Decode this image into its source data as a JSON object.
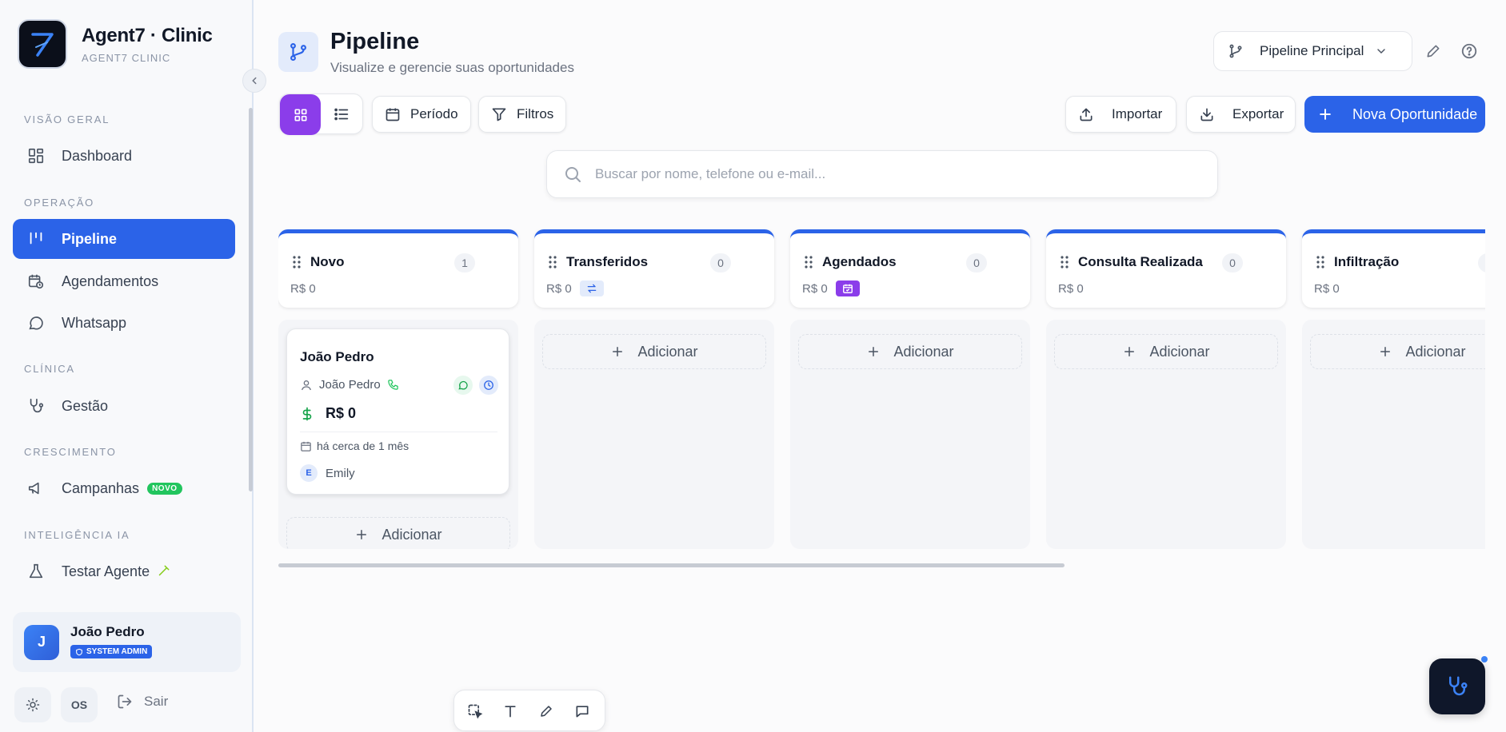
{
  "brand": {
    "title": "Agent7 · Clinic",
    "subtitle": "AGENT7 CLINIC"
  },
  "sidebar": {
    "sections": [
      {
        "label": "VISÃO GERAL"
      },
      {
        "label": "OPERAÇÃO"
      },
      {
        "label": "CLÍNICA"
      },
      {
        "label": "CRESCIMENTO"
      },
      {
        "label": "INTELIGÊNCIA IA"
      }
    ],
    "items": [
      {
        "label": "Dashboard",
        "icon": "dashboard-icon"
      },
      {
        "label": "Pipeline",
        "icon": "pipeline-icon",
        "active": true
      },
      {
        "label": "Agendamentos",
        "icon": "calendar-clock-icon"
      },
      {
        "label": "Whatsapp",
        "icon": "chat-bubble-icon"
      },
      {
        "label": "Gestão",
        "icon": "stethoscope-icon"
      },
      {
        "label": "Campanhas",
        "icon": "megaphone-icon",
        "badge": "NOVO"
      },
      {
        "label": "Testar Agente",
        "icon": "flask-icon"
      }
    ],
    "user": {
      "initial": "J",
      "name": "João Pedro",
      "role": "SYSTEM ADMIN"
    },
    "footer": {
      "language": "OS",
      "logout": "Sair"
    }
  },
  "header": {
    "title": "Pipeline",
    "subtitle": "Visualize e gerencie suas oportunidades",
    "pipeline_select": "Pipeline Principal"
  },
  "toolbar": {
    "period": "Período",
    "filters": "Filtros",
    "import": "Importar",
    "export": "Exportar",
    "new_opportunity": "Nova Oportunidade"
  },
  "search": {
    "placeholder": "Buscar por nome, telefone ou e-mail..."
  },
  "columns": [
    {
      "name": "Novo",
      "count": "1",
      "total": "R$ 0",
      "add_label": "Adicionar"
    },
    {
      "name": "Transferidos",
      "count": "0",
      "total": "R$ 0",
      "add_label": "Adicionar"
    },
    {
      "name": "Agendados",
      "count": "0",
      "total": "R$ 0",
      "add_label": "Adicionar"
    },
    {
      "name": "Consulta Realizada",
      "count": "0",
      "total": "R$ 0",
      "add_label": "Adicionar"
    },
    {
      "name": "Infiltração",
      "count": "",
      "total": "R$ 0",
      "add_label": "Adicionar"
    }
  ],
  "card": {
    "title": "João Pedro",
    "contact": "João Pedro",
    "value": "R$ 0",
    "date": "há cerca de 1 mês",
    "owner_initial": "E",
    "owner": "Emily"
  },
  "colors": {
    "accent": "#2b63e8",
    "purple": "#8b3dea",
    "green": "#22c55e"
  }
}
